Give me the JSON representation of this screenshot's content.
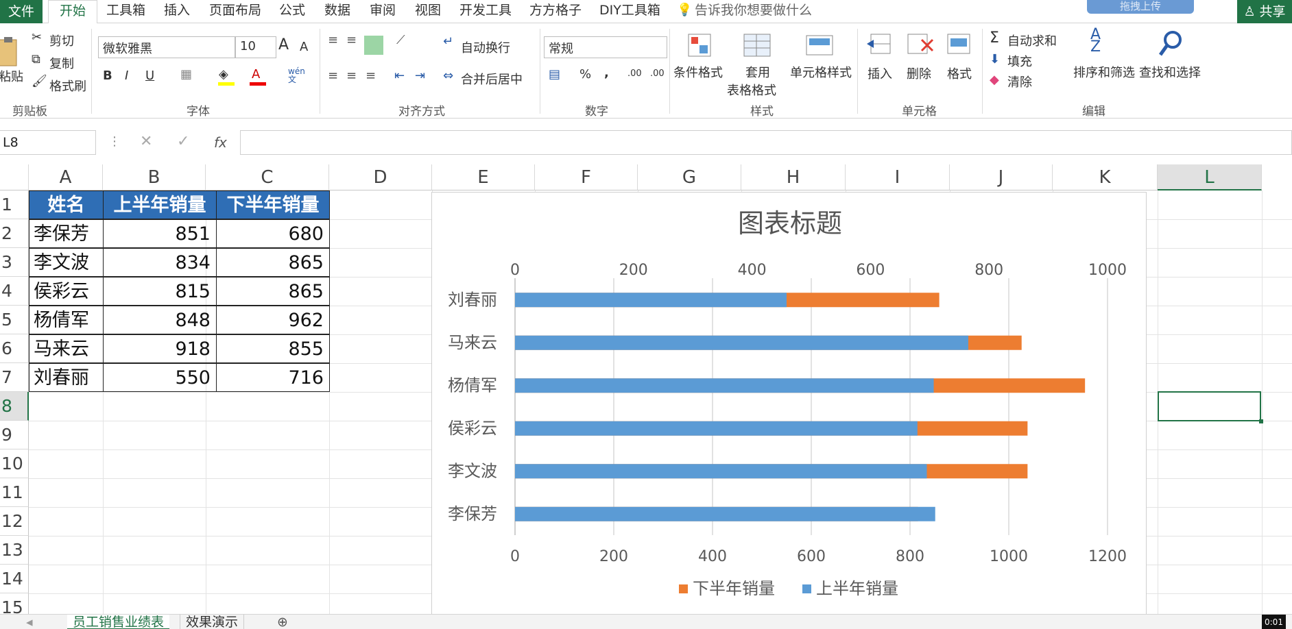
{
  "tabs": {
    "file": "文件",
    "home": "开始",
    "tools": "工具箱",
    "insert": "插入",
    "layout": "页面布局",
    "formula": "公式",
    "data": "数据",
    "review": "审阅",
    "view": "视图",
    "dev": "开发工具",
    "ffgz": "方方格子",
    "diy": "DIY工具箱",
    "tellme": "告诉我你想要做什么",
    "share": "共享",
    "cloud": "拖拽上传"
  },
  "ribbon": {
    "paste": "粘贴",
    "cut": "剪切",
    "copy": "复制",
    "format_painter": "格式刷",
    "clipboard": "剪贴板",
    "font_name": "微软雅黑",
    "font_size": "10",
    "font_group": "字体",
    "phonetic": "wén\n文",
    "wrap": "自动换行",
    "merge": "合并后居中",
    "align_group": "对齐方式",
    "number_format": "常规",
    "number_group": "数字",
    "percent": "%",
    "comma": ",",
    "cond_format": "条件格式",
    "table_format_1": "套用",
    "table_format_2": "表格格式",
    "cell_style": "单元格样式",
    "style_group": "样式",
    "insert": "插入",
    "delete": "删除",
    "format": "格式",
    "cells_group": "单元格",
    "autosum": "自动求和",
    "fill": "填充",
    "clear": "清除",
    "sort": "排序和筛选",
    "find": "查找和选择",
    "edit_group": "编辑"
  },
  "formula_bar": {
    "name_box": "L8",
    "fx": "fx",
    "value": ""
  },
  "columns": [
    "A",
    "B",
    "C",
    "D",
    "E",
    "F",
    "G",
    "H",
    "I",
    "J",
    "K",
    "L"
  ],
  "rows": [
    "1",
    "2",
    "3",
    "4",
    "5",
    "6",
    "7",
    "8",
    "9",
    "10",
    "11",
    "12",
    "13",
    "14",
    "15"
  ],
  "table": {
    "headers": [
      "姓名",
      "上半年销量",
      "下半年销量"
    ],
    "rows": [
      [
        "李保芳",
        "851",
        "680"
      ],
      [
        "李文波",
        "834",
        "865"
      ],
      [
        "侯彩云",
        "815",
        "865"
      ],
      [
        "杨倩军",
        "848",
        "962"
      ],
      [
        "马来云",
        "918",
        "855"
      ],
      [
        "刘春丽",
        "550",
        "716"
      ]
    ]
  },
  "sheet_tabs": [
    "员工销售业绩表",
    "效果演示"
  ],
  "timestamp": "0:01",
  "chart_data": {
    "type": "bar",
    "title": "图表标题",
    "categories": [
      "刘春丽",
      "马来云",
      "杨倩军",
      "侯彩云",
      "李文波",
      "李保芳"
    ],
    "series": [
      {
        "name": "上半年销量",
        "color": "#5b9bd5",
        "axis": "primary",
        "values": [
          550,
          918,
          848,
          815,
          834,
          851
        ]
      },
      {
        "name": "下半年销量",
        "color": "#ed7d31",
        "axis": "secondary",
        "values": [
          716,
          855,
          962,
          865,
          865,
          680
        ]
      }
    ],
    "primary_axis": {
      "ticks": [
        "0",
        "200",
        "400",
        "600",
        "800",
        "1000",
        "1200"
      ],
      "max": 1200,
      "position": "bottom"
    },
    "secondary_axis": {
      "ticks": [
        "0",
        "200",
        "400",
        "600",
        "800",
        "1000"
      ],
      "max": 1000,
      "position": "top"
    },
    "legend": [
      "下半年销量",
      "上半年销量"
    ],
    "legend_position": "bottom",
    "grid": true
  }
}
